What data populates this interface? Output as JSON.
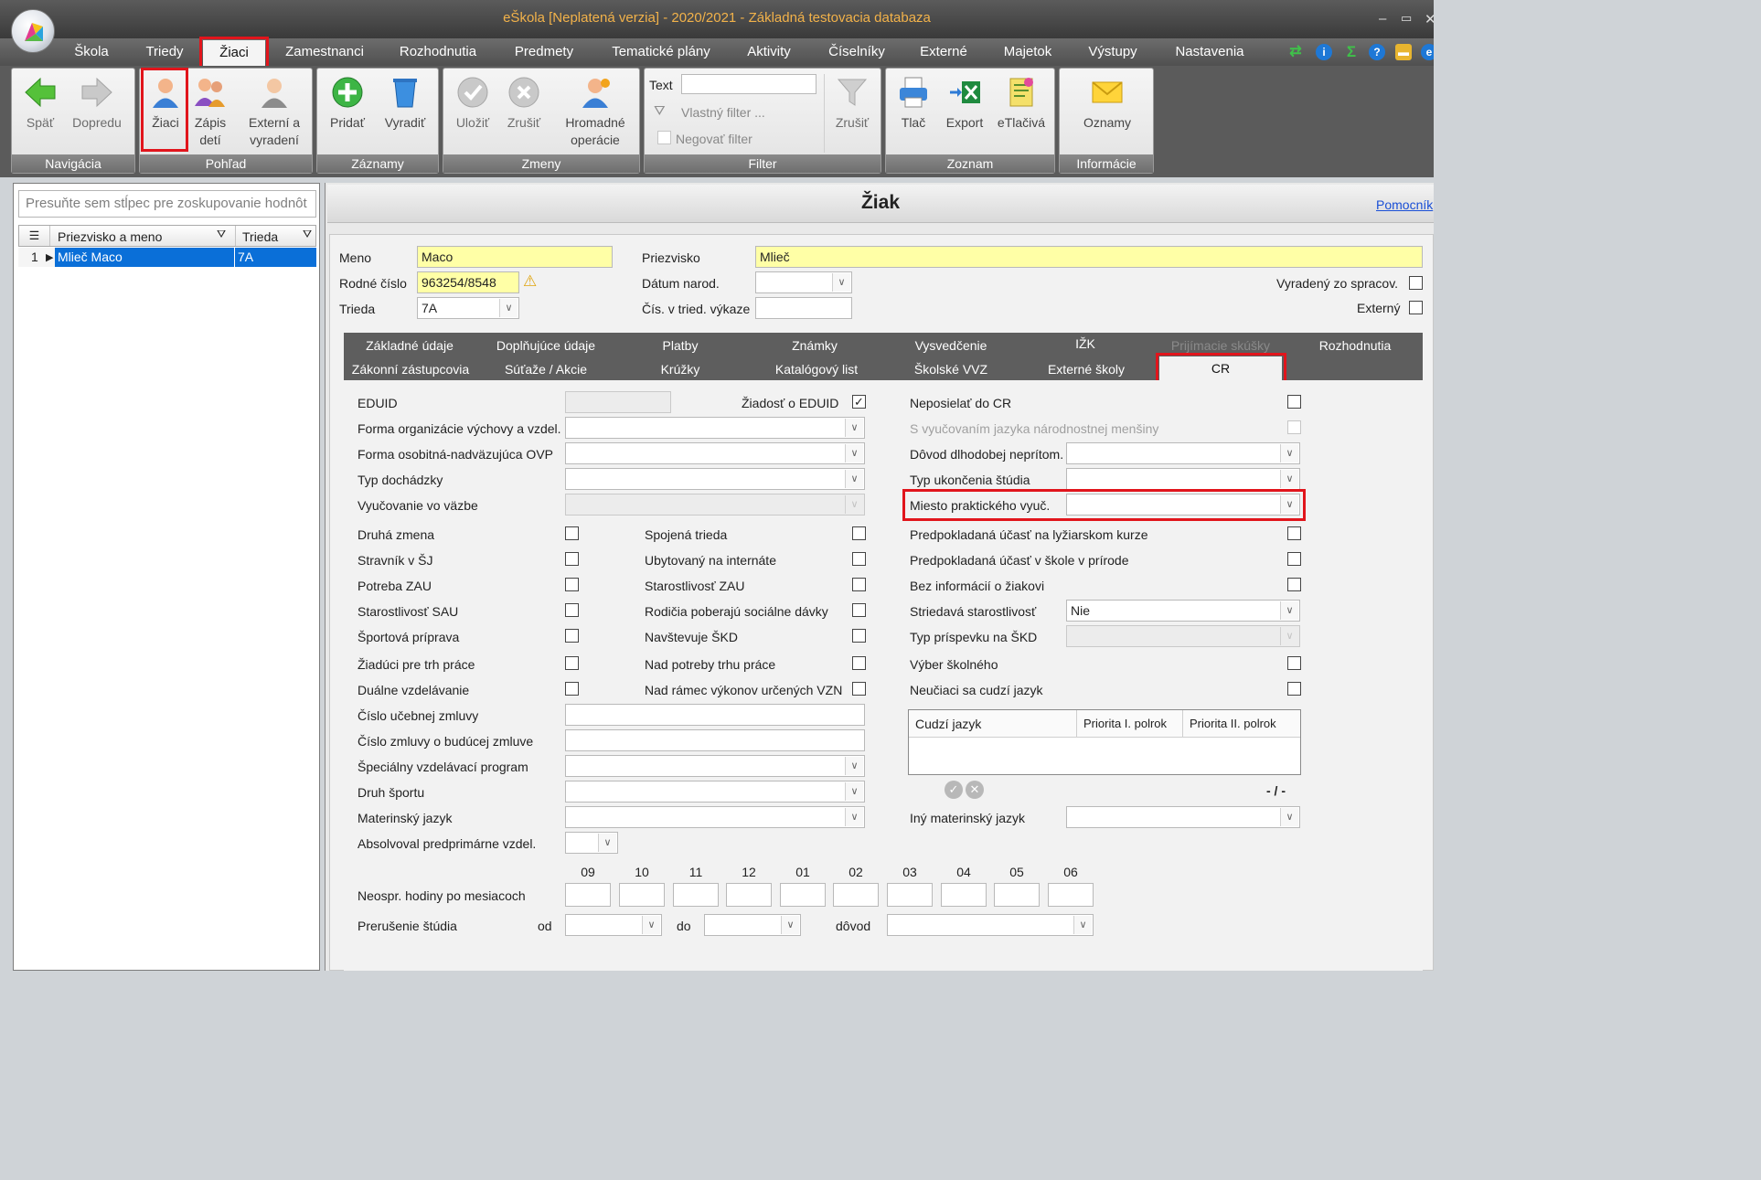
{
  "window": {
    "title": "eŠkola [Neplatená verzia] - 2020/2021 - Základná testovacia databaza"
  },
  "menu": {
    "tabs": [
      "Škola",
      "Triedy",
      "Žiaci",
      "Zamestnanci",
      "Rozhodnutia",
      "Predmety",
      "Tematické plány",
      "Aktivity",
      "Číselníky",
      "Externé",
      "Majetok",
      "Výstupy",
      "Nastavenia"
    ],
    "active": "Žiaci"
  },
  "ribbon": {
    "navigacia": {
      "caption": "Navigácia",
      "back": "Späť",
      "forward": "Dopredu"
    },
    "pohlad": {
      "caption": "Pohľad",
      "students": "Žiaci",
      "enroll_l1": "Zápis",
      "enroll_l2": "detí",
      "external_l1": "Externí a",
      "external_l2": "vyradení"
    },
    "zaznamy": {
      "caption": "Záznamy",
      "add": "Pridať",
      "remove": "Vyradiť"
    },
    "zmeny": {
      "caption": "Zmeny",
      "save": "Uložiť",
      "cancel": "Zrušiť",
      "batch_l1": "Hromadné",
      "batch_l2": "operácie"
    },
    "filter": {
      "caption": "Filter",
      "text_label": "Text",
      "own_filter": "Vlastný filter ...",
      "negate": "Negovať filter",
      "cancel": "Zrušiť"
    },
    "zoznam": {
      "caption": "Zoznam",
      "print": "Tlač",
      "export": "Export",
      "eprint": "eTlačivá"
    },
    "informacie": {
      "caption": "Informácie",
      "notices": "Oznamy"
    }
  },
  "grid": {
    "group_placeholder": "Presuňte sem stĺpec pre zoskupovanie hodnôt",
    "columns": [
      "Priezvisko a meno",
      "Trieda"
    ],
    "rows": [
      {
        "num": "1",
        "name": "Mlieč Maco",
        "class": "7A"
      }
    ]
  },
  "panel": {
    "title": "Žiak",
    "helper": "Pomocník"
  },
  "header": {
    "meno_label": "Meno",
    "meno": "Maco",
    "priezvisko_label": "Priezvisko",
    "priezvisko": "Mlieč",
    "rodne_label": "Rodné číslo",
    "rodne": "963254/8548",
    "datum_label": "Dátum narod.",
    "trieda_label": "Trieda",
    "trieda": "7A",
    "cis_label": "Čís. v tried. výkaze",
    "vyradeny_label": "Vyradený zo spracov.",
    "externy_label": "Externý"
  },
  "tabs_row1": [
    "Základné údaje",
    "Doplňujúce údaje",
    "Platby",
    "Známky",
    "Vysvedčenie",
    "IŽK",
    "Prijímacie skúšky",
    "Rozhodnutia"
  ],
  "tabs_row2": [
    "Zákonní zástupcovia",
    "Súťaže / Akcie",
    "Krúžky",
    "Katalógový list",
    "Školské VVZ",
    "Externé školy",
    "CR"
  ],
  "cr": {
    "eduid": "EDUID",
    "ziadost": "Žiadosť o EDUID",
    "forma_org": "Forma organizácie výchovy a vzdel.",
    "forma_osob": "Forma osobitná-nadväzujúca OVP",
    "typ_doch": "Typ dochádzky",
    "vyuc_vazbe": "Vyučovanie vo väzbe",
    "left_checks": [
      "Druhá zmena",
      "Stravník v ŠJ",
      "Potreba ZAU",
      "Starostlivosť SAU",
      "Športová príprava",
      "Žiadúci pre trh práce",
      "Duálne vzdelávanie"
    ],
    "mid_checks": [
      "Spojená trieda",
      "Ubytovaný na internáte",
      "Starostlivosť ZAU",
      "Rodičia poberajú sociálne dávky",
      "Navštevuje ŠKD",
      "Nad potreby trhu práce",
      "Nad rámec výkonov určených VZN"
    ],
    "cislo_ucebnej": "Číslo učebnej zmluvy",
    "cislo_buducej": "Číslo zmluvy o budúcej zmluve",
    "spec_program": "Špeciálny vzdelávací program",
    "druh_sportu": "Druh športu",
    "materinsky": "Materinský jazyk",
    "absolvoval": "Absolvoval predprimárne vzdel.",
    "neposielat": "Neposielať do CR",
    "s_vyuc": "S vyučovaním jazyka národnostnej menšiny",
    "dovod": "Dôvod dlhodobej neprítom.",
    "typ_ukonc": "Typ ukončenia štúdia",
    "miesto": "Miesto praktického vyuč.",
    "right_checks": [
      "Predpokladaná účasť na lyžiarskom kurze",
      "Predpokladaná účasť v škole v prírode",
      "Bez informácií o žiakovi"
    ],
    "striedava": "Striedavá starostlivosť",
    "striedava_val": "Nie",
    "typ_prisp": "Typ príspevku na ŠKD",
    "vyber_skol": "Výber školného",
    "neuciaci": "Neučiaci sa cudzí jazyk",
    "lang_cols": [
      "Cudzí jazyk",
      "Priorita I. polrok",
      "Priorita II. polrok"
    ],
    "pager": "- / -",
    "iny_mat": "Iný materinský jazyk",
    "months": [
      "09",
      "10",
      "11",
      "12",
      "01",
      "02",
      "03",
      "04",
      "05",
      "06"
    ],
    "neospr": "Neospr. hodiny po mesiacoch",
    "prerusenie": "Prerušenie štúdia",
    "od": "od",
    "do": "do",
    "dovod2": "dôvod"
  },
  "colors": {
    "accent_red": "#e1151c",
    "selection": "#0a6fd8",
    "required_yellow": "#ffffa6"
  }
}
